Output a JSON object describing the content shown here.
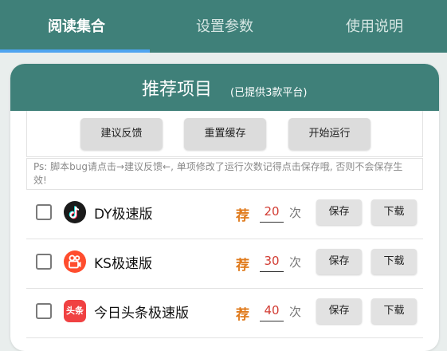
{
  "tabs": [
    {
      "label": "阅读集合",
      "active": true
    },
    {
      "label": "设置参数",
      "active": false
    },
    {
      "label": "使用说明",
      "active": false
    }
  ],
  "card": {
    "title": "推荐项目",
    "subtitle": "(已提供3款平台)"
  },
  "actions": {
    "feedback": "建议反馈",
    "reset_cache": "重置缓存",
    "start": "开始运行"
  },
  "notice": "Ps: 脚本bug请点击→建议反馈←, 单项修改了运行次数记得点击保存哦, 否则不会保存生效!",
  "apps": [
    {
      "name": "DY极速版",
      "rec_label": "荐",
      "count": "20",
      "unit": "次",
      "save_label": "保存",
      "download_label": "下载",
      "checked": false,
      "icon": "douyin-icon"
    },
    {
      "name": "KS极速版",
      "rec_label": "荐",
      "count": "30",
      "unit": "次",
      "save_label": "保存",
      "download_label": "下载",
      "checked": false,
      "icon": "kuaishou-icon"
    },
    {
      "name": "今日头条极速版",
      "rec_label": "荐",
      "count": "40",
      "unit": "次",
      "save_label": "保存",
      "download_label": "下载",
      "checked": false,
      "icon": "toutiao-icon",
      "icon_text": "头条"
    }
  ],
  "colors": {
    "primary": "#3f8079",
    "tab_indicator": "#4fa4f0",
    "rec_accent": "#e07b1d",
    "count_text": "#d23c33"
  }
}
